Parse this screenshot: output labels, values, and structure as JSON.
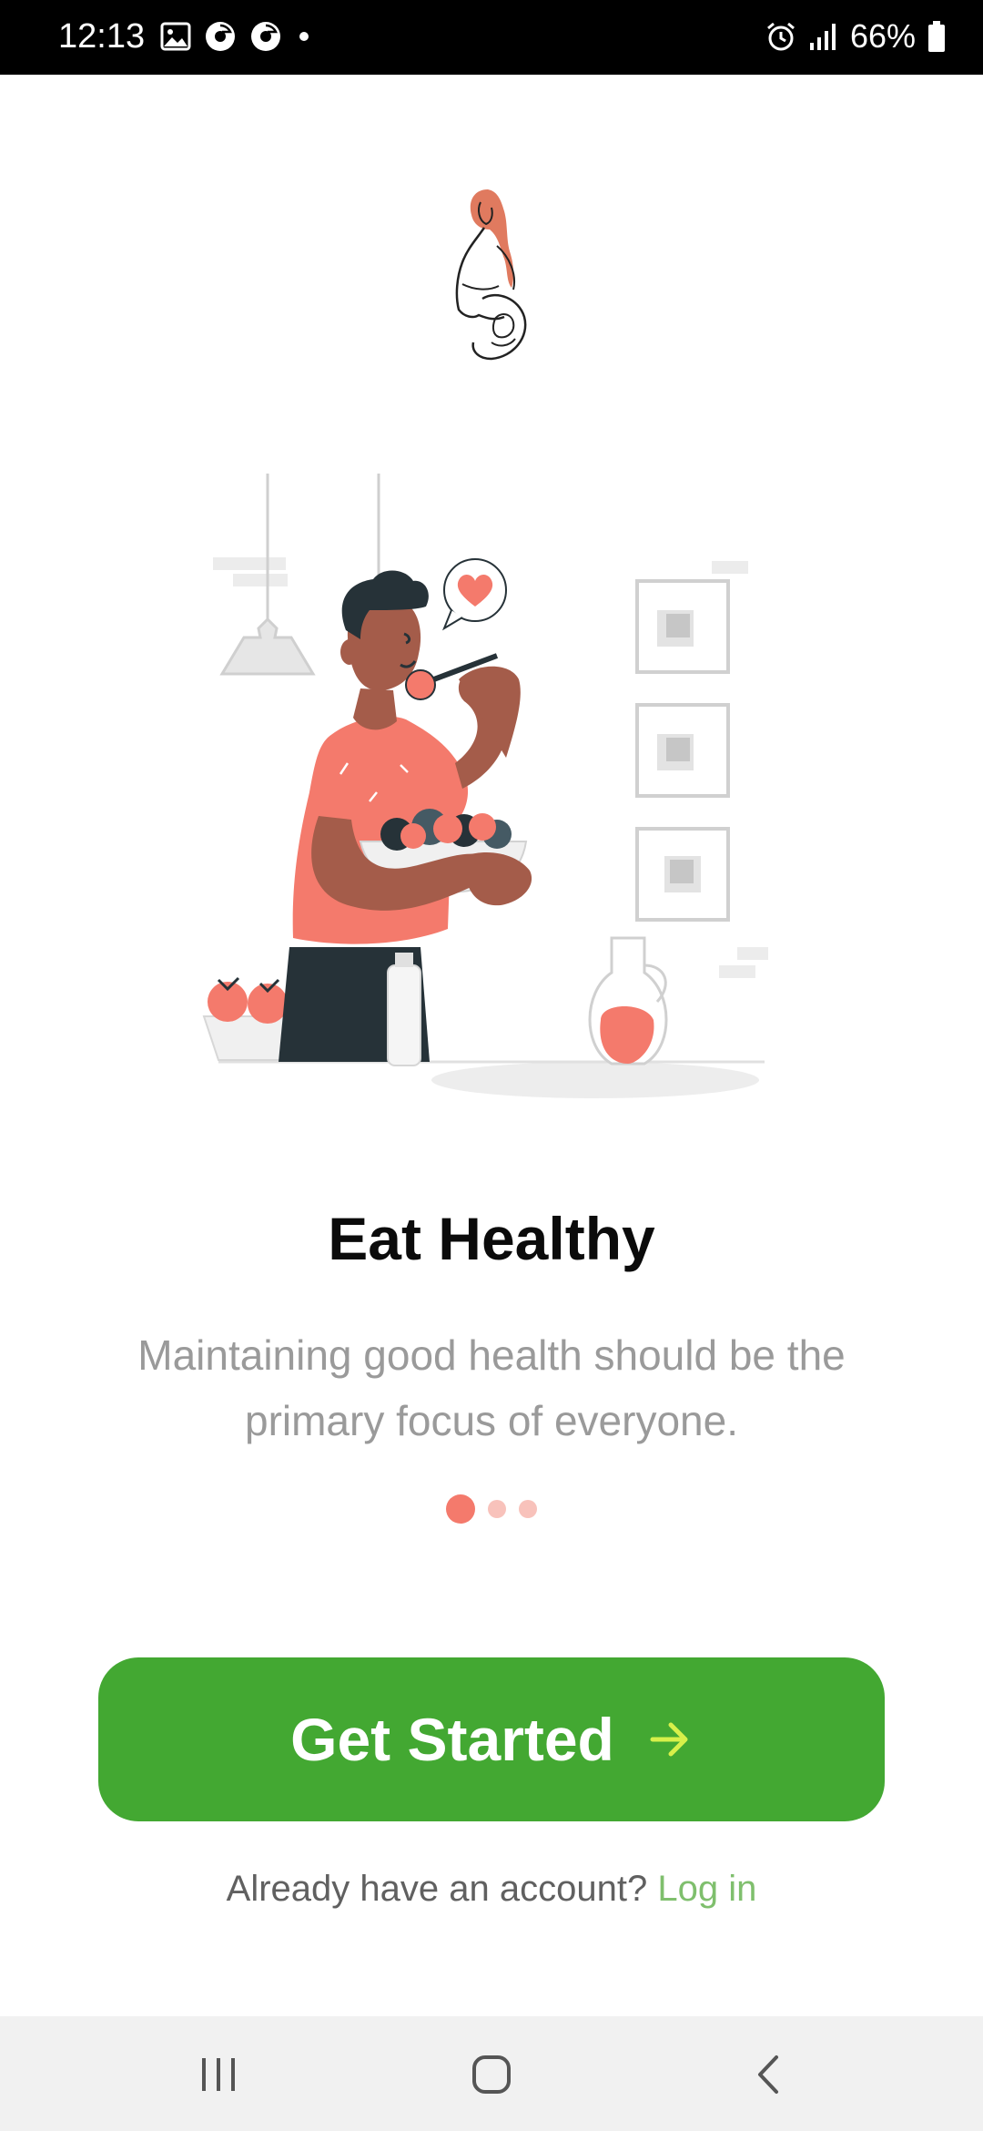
{
  "status_bar": {
    "time": "12:13",
    "battery": "66%",
    "left_icons": [
      "gallery-icon",
      "chrome-icon",
      "chrome-icon",
      "dot-icon"
    ],
    "right_icons": [
      "alarm-icon",
      "signal-icon",
      "battery-icon"
    ]
  },
  "onboarding": {
    "title": "Eat Healthy",
    "subtitle": "Maintaining good health should be the primary focus of everyone.",
    "page_indicator": {
      "current": 1,
      "total": 3
    }
  },
  "cta": {
    "label": "Get Started",
    "icon": "arrow-right-icon"
  },
  "login": {
    "prompt": "Already have an account?",
    "link": "Log in"
  },
  "colors": {
    "primary_green": "#43a832",
    "accent_coral": "#f47a6c",
    "link_green": "#7fbf6d",
    "arrow_lime": "#d7f04a"
  },
  "nav_bar": {
    "buttons": [
      "recent-apps-icon",
      "home-icon",
      "back-icon"
    ]
  }
}
